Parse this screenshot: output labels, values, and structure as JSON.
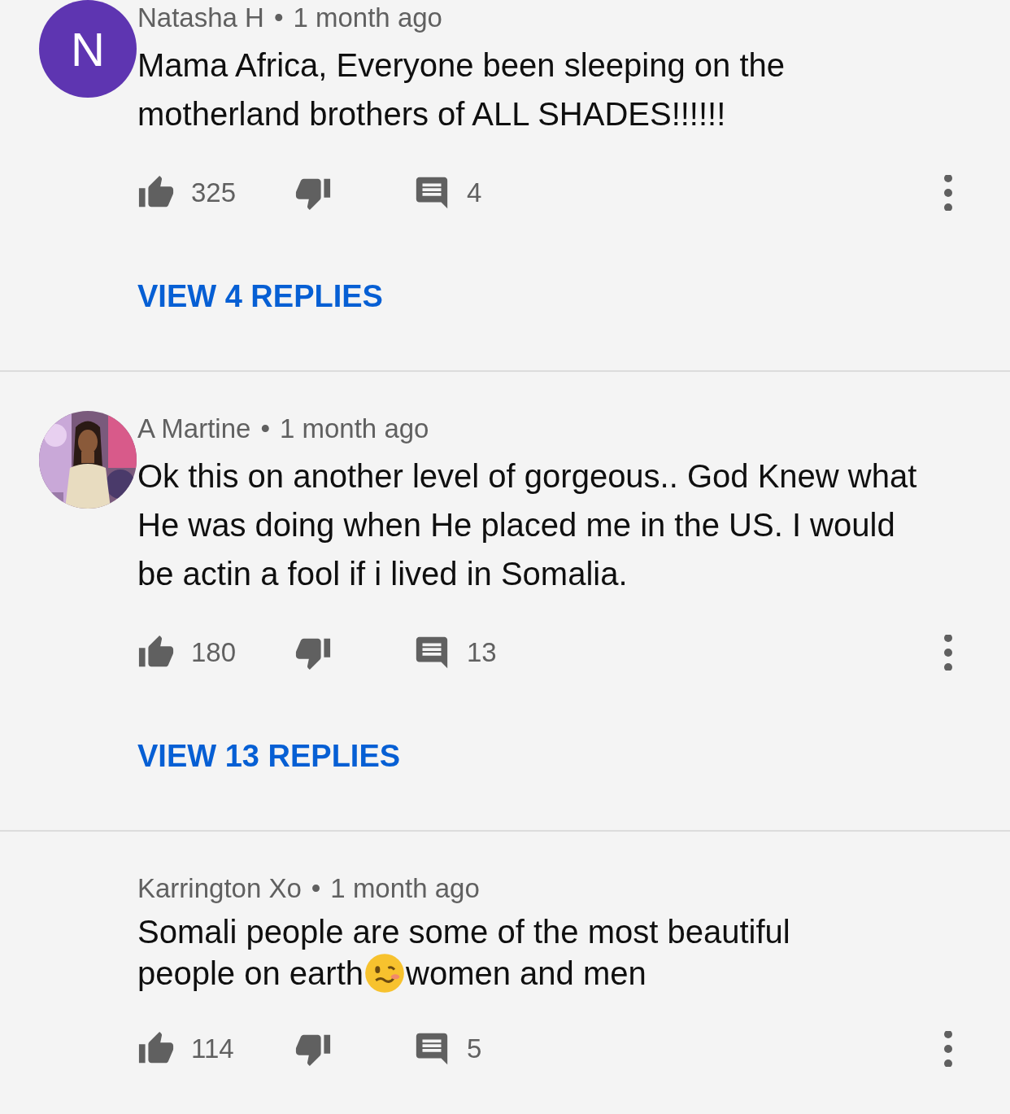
{
  "comments": [
    {
      "avatar": {
        "kind": "letter",
        "letter": "N"
      },
      "author": "Natasha H",
      "separator": "•",
      "time": "1 month ago",
      "body": [
        {
          "kind": "text",
          "text": "Mama Africa, Everyone been sleeping on the motherland brothers of ALL SHADES!!!!!!"
        }
      ],
      "likes": "325",
      "replies_count": "4",
      "view_replies": "VIEW 4 REPLIES"
    },
    {
      "author": "A Martine",
      "separator": "•",
      "time": "1 month ago",
      "body": [
        {
          "kind": "text",
          "text": "Ok this on another level of gorgeous.. God Knew what He was doing when He placed me in the US. I would be actin a fool if i lived in Somalia."
        }
      ],
      "likes": "180",
      "replies_count": "13",
      "view_replies": "VIEW 13 REPLIES"
    },
    {
      "author": "Karrington Xo",
      "separator": "•",
      "time": "1 month ago",
      "body": [
        {
          "kind": "text",
          "text": "Somali people are some of the most beautiful"
        },
        {
          "kind": "text",
          "text": "people on earth"
        },
        {
          "kind": "emoji"
        },
        {
          "kind": "text",
          "text": "women and men"
        }
      ],
      "likes": "114",
      "replies_count": "5"
    }
  ]
}
